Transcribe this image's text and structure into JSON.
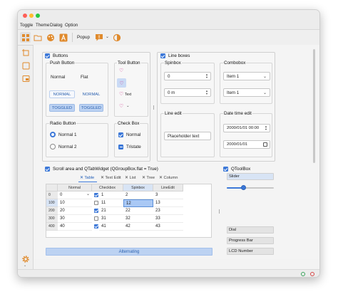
{
  "menu": [
    "Toggle",
    "Theme",
    "Dialog",
    "Option"
  ],
  "toolbar": {
    "popup_label": "Popup"
  },
  "buttons_group": {
    "title": "Buttons",
    "push": {
      "title": "Push Button",
      "normal": "Normal",
      "flat": "Flat",
      "normal_caps": "NORMAL",
      "normal_caps2": "NORMAL",
      "toggled": "TOGGLED",
      "toggled2": "TOGGLED"
    },
    "tool": {
      "title": "Tool Button",
      "text": "Text"
    },
    "radio": {
      "title": "Radio Button",
      "opt1": "Normal 1",
      "opt2": "Normal 2"
    },
    "check": {
      "title": "Check Box",
      "normal": "Normal",
      "tristate": "Tristate"
    }
  },
  "line_boxes": {
    "title": "Line boxes",
    "spinbox": {
      "title": "Spinbox",
      "value1": "0",
      "value2": "0 m"
    },
    "combobox": {
      "title": "Combobox",
      "item1": "Item 1",
      "item2": "Item 1"
    },
    "line_edit": {
      "title": "Line edit",
      "placeholder": "Placeholder text"
    },
    "datetime": {
      "title": "Date time edit",
      "value1": "2000/01/01 00:00",
      "value2": "2000/01/01"
    }
  },
  "scroll_area": {
    "title": "Scroll area and QTabWidget (QGroupBox.flat = True)",
    "tabs": [
      "Table",
      "Text Edit",
      "List",
      "Tree",
      "Column"
    ],
    "columns": [
      "Normal",
      "Checkbox",
      "Spinbox",
      "LineEdit"
    ],
    "rows": [
      {
        "header": "0",
        "normal": "0",
        "checked": true,
        "check_val": "1",
        "spin": "2",
        "edit": "3"
      },
      {
        "header": "100",
        "normal": "10",
        "checked": false,
        "check_val": "11",
        "spin": "12",
        "edit": "13"
      },
      {
        "header": "200",
        "normal": "20",
        "checked": true,
        "check_val": "21",
        "spin": "22",
        "edit": "23"
      },
      {
        "header": "300",
        "normal": "30",
        "checked": false,
        "check_val": "31",
        "spin": "32",
        "edit": "33"
      },
      {
        "header": "400",
        "normal": "40",
        "checked": true,
        "check_val": "41",
        "spin": "42",
        "edit": "43"
      }
    ],
    "alternating_button": "Alternating"
  },
  "toolbox": {
    "title": "QToolBox",
    "slider_label": "Slider",
    "slider_value": 0.35,
    "items": [
      "Dial",
      "Progress Bar",
      "LCD Number"
    ]
  },
  "colors": {
    "accent": "#3c78d8",
    "selection": "#a9c8f5",
    "toggled": "#bcd2f2"
  }
}
